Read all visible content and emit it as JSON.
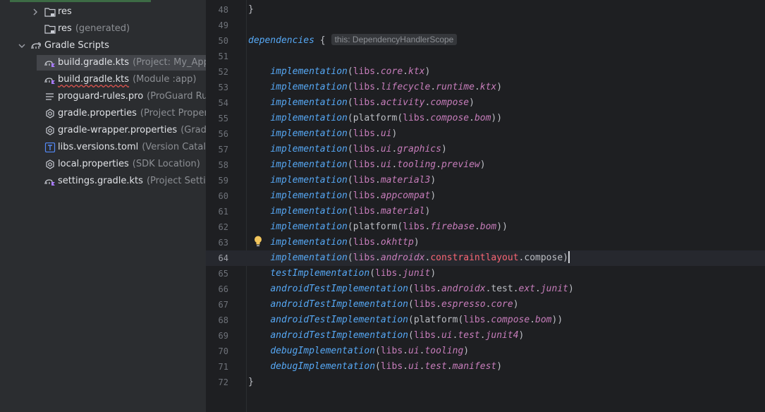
{
  "project_tree": {
    "items": [
      {
        "name": "res",
        "hint": "",
        "icon": "folder-icon",
        "expandable": true
      },
      {
        "name": "res",
        "hint": "(generated)",
        "icon": "folder-icon",
        "expandable": false
      },
      {
        "name": "Gradle Scripts",
        "hint": "",
        "icon": "gradle-elephant-icon",
        "expandable": true,
        "expanded": true
      },
      {
        "name": "build.gradle.kts",
        "hint": "(Project: My_Appl",
        "icon": "gradle-kotlin-icon",
        "selected": true
      },
      {
        "name": "build.gradle.kts",
        "hint": "(Module :app)",
        "icon": "gradle-kotlin-icon",
        "has_error": true
      },
      {
        "name": "proguard-rules.pro",
        "hint": "(ProGuard Rul",
        "icon": "text-file-icon"
      },
      {
        "name": "gradle.properties",
        "hint": "(Project Propert",
        "icon": "settings-gear-icon"
      },
      {
        "name": "gradle-wrapper.properties",
        "hint": "(Gradle",
        "icon": "settings-gear-icon"
      },
      {
        "name": "libs.versions.toml",
        "hint": "(Version Catalo",
        "icon": "toml-file-icon"
      },
      {
        "name": "local.properties",
        "hint": "(SDK Location)",
        "icon": "settings-gear-icon"
      },
      {
        "name": "settings.gradle.kts",
        "hint": "(Project Settin",
        "icon": "gradle-kotlin-icon"
      }
    ]
  },
  "editor": {
    "current_line": "64",
    "inlay_hint": "this: DependencyHandlerScope",
    "lines": [
      {
        "num": "48"
      },
      {
        "num": "49"
      },
      {
        "num": "50"
      },
      {
        "num": "51"
      },
      {
        "num": "52"
      },
      {
        "num": "53"
      },
      {
        "num": "54"
      },
      {
        "num": "55"
      },
      {
        "num": "56"
      },
      {
        "num": "57"
      },
      {
        "num": "58"
      },
      {
        "num": "59"
      },
      {
        "num": "60"
      },
      {
        "num": "61"
      },
      {
        "num": "62"
      },
      {
        "num": "63"
      },
      {
        "num": "64"
      },
      {
        "num": "65"
      },
      {
        "num": "66"
      },
      {
        "num": "67"
      },
      {
        "num": "68"
      },
      {
        "num": "69"
      },
      {
        "num": "70"
      },
      {
        "num": "71"
      },
      {
        "num": "72"
      }
    ],
    "code": {
      "l48": "}",
      "l50_kw": "dependencies",
      "l50_brace": " {",
      "impl": "implementation",
      "testImpl": "testImplementation",
      "androidTestImpl": "androidTestImplementation",
      "debugImpl": "debugImplementation",
      "platform": "platform",
      "libs": "libs",
      "close": "}"
    }
  },
  "colors": {
    "background": "#1e1f22",
    "sidebar": "#2b2d30",
    "function": "#56a8f5",
    "libs": "#c77dbb",
    "error_ref": "#fa6675",
    "text": "#bcbec4"
  }
}
